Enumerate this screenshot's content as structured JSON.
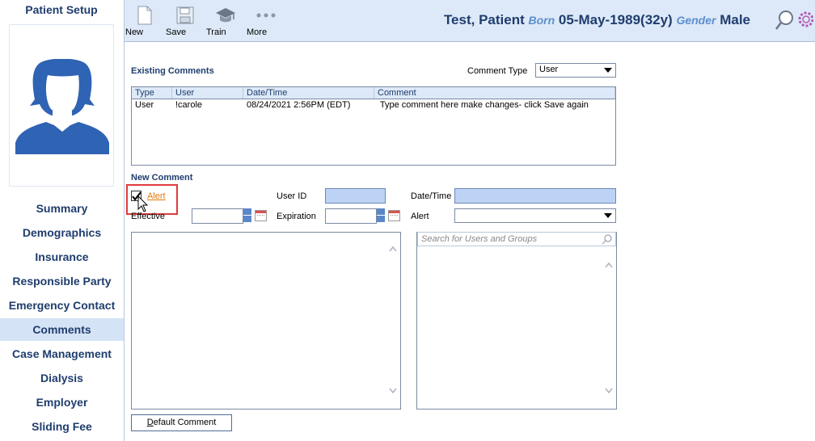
{
  "sidebar": {
    "title": "Patient Setup",
    "items": [
      {
        "label": "Summary"
      },
      {
        "label": "Demographics"
      },
      {
        "label": "Insurance"
      },
      {
        "label": "Responsible Party"
      },
      {
        "label": "Emergency Contact"
      },
      {
        "label": "Comments",
        "active": true
      },
      {
        "label": "Case Management"
      },
      {
        "label": "Dialysis"
      },
      {
        "label": "Employer"
      },
      {
        "label": "Sliding Fee"
      }
    ]
  },
  "toolbar": {
    "new_label": "New",
    "save_label": "Save",
    "train_label": "Train",
    "more_label": "More"
  },
  "patient": {
    "name": "Test, Patient",
    "born_label": "Born",
    "dob": "05-May-1989(32y)",
    "gender_label": "Gender",
    "gender": "Male"
  },
  "existing": {
    "title": "Existing Comments",
    "type_label": "Comment Type",
    "type_value": "User",
    "columns": [
      "Type",
      "User",
      "Date/Time",
      "Comment"
    ],
    "rows": [
      {
        "type": "User",
        "user": "!carole",
        "datetime": "08/24/2021 2:56PM (EDT)",
        "comment": " Type comment here make changes- click Save again"
      }
    ]
  },
  "new_comment": {
    "title": "New Comment",
    "alert_checked": true,
    "alert_link": "Alert",
    "user_id_label": "User ID",
    "user_id_value": "",
    "datetime_label": "Date/Time",
    "datetime_value": "",
    "effective_label": "Effective",
    "expiration_label": "Expiration",
    "alert_label": "Alert",
    "search_placeholder": "Search for Users and Groups",
    "default_button": "Default Comment"
  },
  "colors": {
    "accent": "#1f3d6d",
    "header_bg": "#dde9f8",
    "active_nav": "#d5e3f6",
    "highlight": "#e03b3b",
    "link": "#e07a10"
  }
}
